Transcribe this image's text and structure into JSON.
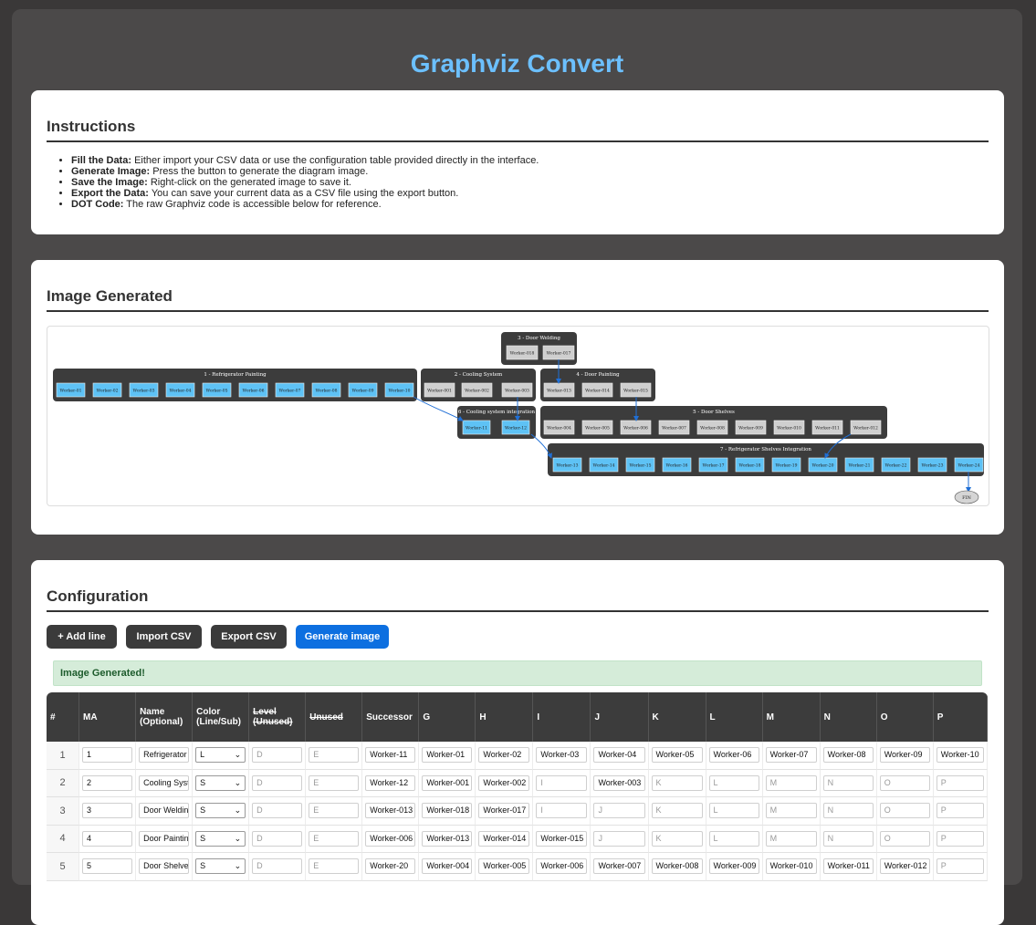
{
  "app_title": "Graphviz Convert",
  "instructions": {
    "heading": "Instructions",
    "items": [
      {
        "bold": "Fill the Data:",
        "text": " Either import your CSV data or use the configuration table provided directly in the interface."
      },
      {
        "bold": "Generate Image:",
        "text": " Press the button to generate the diagram image."
      },
      {
        "bold": "Save the Image:",
        "text": " Right-click on the generated image to save it."
      },
      {
        "bold": "Export the Data:",
        "text": " You can save your current data as a CSV file using the export button."
      },
      {
        "bold": "DOT Code:",
        "text": " The raw Graphviz code is accessible below for reference."
      }
    ]
  },
  "image_section": {
    "heading": "Image Generated",
    "clusters": [
      {
        "label": "3 - Door Welding",
        "nodes": [
          "Worker-018",
          "Worker-017"
        ],
        "highlight": false
      },
      {
        "label": "1 - Refrigerator Painting",
        "nodes": [
          "Worker-01",
          "Worker-02",
          "Worker-03",
          "Worker-04",
          "Worker-05",
          "Worker-06",
          "Worker-07",
          "Worker-08",
          "Worker-09",
          "Worker-10"
        ],
        "highlight": true
      },
      {
        "label": "2 - Cooling System",
        "nodes": [
          "Worker-001",
          "Worker-002",
          "Worker-003"
        ],
        "highlight": false
      },
      {
        "label": "4 - Door Painting",
        "nodes": [
          "Worker-013",
          "Worker-014",
          "Worker-015"
        ],
        "highlight": false
      },
      {
        "label": "6 - Cooling system integration",
        "nodes": [
          "Worker-11",
          "Worker-12"
        ],
        "highlight": true
      },
      {
        "label": "5 - Door Shelves",
        "nodes": [
          "Worker-004",
          "Worker-005",
          "Worker-006",
          "Worker-007",
          "Worker-008",
          "Worker-009",
          "Worker-010",
          "Worker-011",
          "Worker-012"
        ],
        "highlight": false
      },
      {
        "label": "7 - Refrigerator Shelves Integration",
        "nodes": [
          "Worker-13",
          "Worker-14",
          "Worker-15",
          "Worker-16",
          "Worker-17",
          "Worker-18",
          "Worker-19",
          "Worker-20",
          "Worker-21",
          "Worker-22",
          "Worker-23",
          "Worker-24"
        ],
        "highlight": true
      }
    ],
    "end_node": "FIN"
  },
  "configuration": {
    "heading": "Configuration",
    "buttons": {
      "add": "+ Add line",
      "import": "Import CSV",
      "export": "Export CSV",
      "generate": "Generate image"
    },
    "status": "Image Generated!",
    "columns": [
      "#",
      "MA",
      "Name\n(Optional)",
      "Color\n(Line/Sub)",
      "Level\n(Unused)",
      "Unused",
      "Successor",
      "G",
      "H",
      "I",
      "J",
      "K",
      "L",
      "M",
      "N",
      "O",
      "P"
    ],
    "rows": [
      {
        "num": "1",
        "ma": "1",
        "name": "Refrigerator P",
        "color": "L",
        "level": "D",
        "unused": "E",
        "successor": "Worker-11",
        "extra": [
          "Worker-01",
          "Worker-02",
          "Worker-03",
          "Worker-04",
          "Worker-05",
          "Worker-06",
          "Worker-07",
          "Worker-08",
          "Worker-09",
          "Worker-10"
        ]
      },
      {
        "num": "2",
        "ma": "2",
        "name": "Cooling Syste",
        "color": "S",
        "level": "D",
        "unused": "E",
        "successor": "Worker-12",
        "extra": [
          "Worker-001",
          "Worker-002",
          "I",
          "Worker-003",
          "K",
          "L",
          "M",
          "N",
          "O",
          "P"
        ]
      },
      {
        "num": "3",
        "ma": "3",
        "name": "Door Welding",
        "color": "S",
        "level": "D",
        "unused": "E",
        "successor": "Worker-013",
        "extra": [
          "Worker-018",
          "Worker-017",
          "I",
          "J",
          "K",
          "L",
          "M",
          "N",
          "O",
          "P"
        ]
      },
      {
        "num": "4",
        "ma": "4",
        "name": "Door Painting",
        "color": "S",
        "level": "D",
        "unused": "E",
        "successor": "Worker-006",
        "extra": [
          "Worker-013",
          "Worker-014",
          "Worker-015",
          "J",
          "K",
          "L",
          "M",
          "N",
          "O",
          "P"
        ]
      },
      {
        "num": "5",
        "ma": "5",
        "name": "Door Shelves",
        "color": "S",
        "level": "D",
        "unused": "E",
        "successor": "Worker-20",
        "extra": [
          "Worker-004",
          "Worker-005",
          "Worker-006",
          "Worker-007",
          "Worker-008",
          "Worker-009",
          "Worker-010",
          "Worker-011",
          "Worker-012",
          "P"
        ]
      }
    ]
  },
  "colors": {
    "accent": "#6cc0ff",
    "primary_button": "#0d6fe0",
    "node_highlight": "#5ec2f5",
    "node_gray": "#cfcfcf",
    "cluster_bg": "#3c3c3c",
    "edge": "#1f6fd6"
  }
}
